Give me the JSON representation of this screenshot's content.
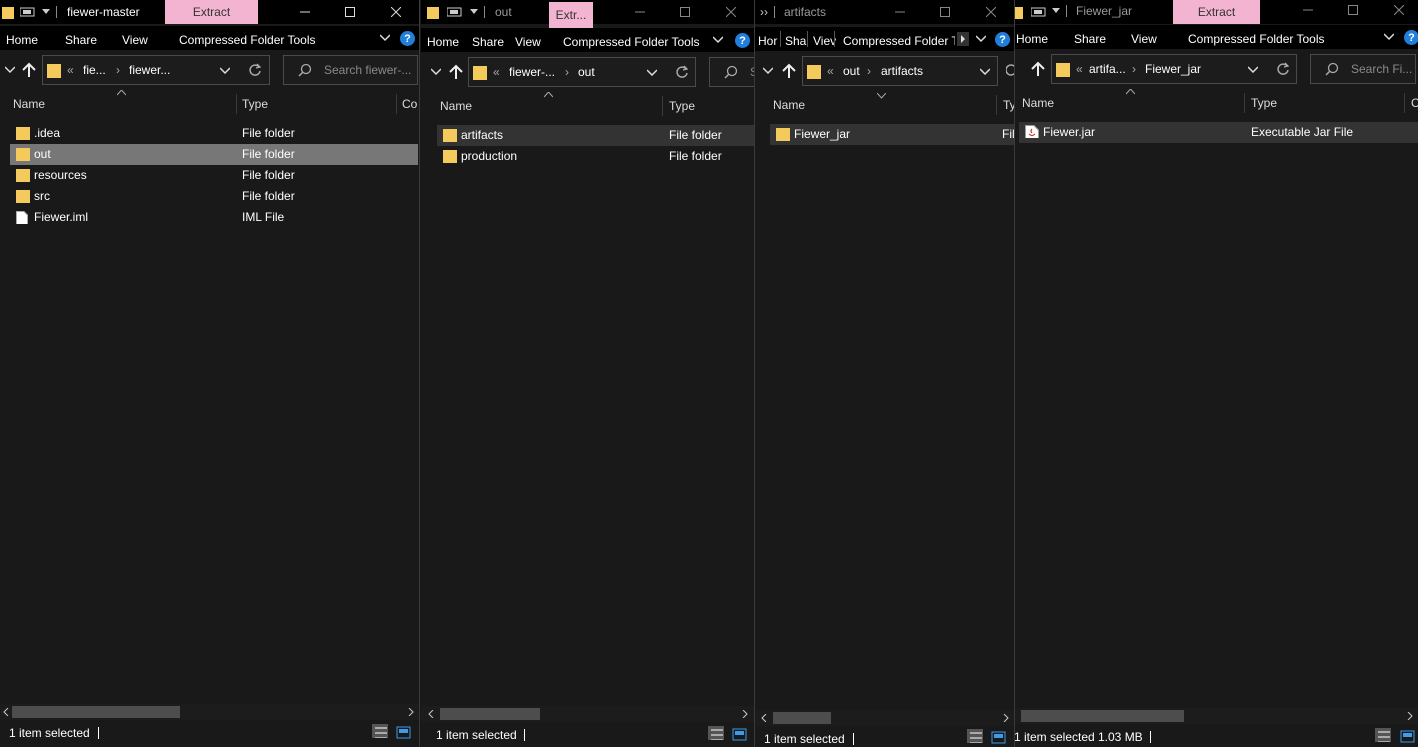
{
  "ribbon_labels": {
    "home": "Home",
    "share": "Share",
    "view": "View",
    "tools": "Compressed Folder Tools"
  },
  "windows": [
    {
      "title": "fiewer-master",
      "extract": "Extract",
      "ribbon": {
        "home": "Home",
        "share": "Share",
        "view": "View",
        "tools": "Compressed Folder Tools"
      },
      "address": {
        "seg1": "fie...",
        "seg2": "fiewer..."
      },
      "search_placeholder": "Search fiewer-...",
      "columns": {
        "name": "Name",
        "type": "Type",
        "extra": "Co"
      },
      "rows": [
        {
          "name": ".idea",
          "type": "File folder"
        },
        {
          "name": "out",
          "type": "File folder"
        },
        {
          "name": "resources",
          "type": "File folder"
        },
        {
          "name": "src",
          "type": "File folder"
        },
        {
          "name": "Fiewer.iml",
          "type": "IML File"
        }
      ],
      "status": "1 item selected"
    },
    {
      "title": "out",
      "extract": "Extr...",
      "ribbon": {
        "home": "Home",
        "share": "Share",
        "view": "View",
        "tools": "Compressed Folder Tools"
      },
      "address": {
        "seg1": "fiewer-...",
        "seg2": "out"
      },
      "search_placeholder": "S",
      "columns": {
        "name": "Name",
        "type": "Type"
      },
      "rows": [
        {
          "name": "artifacts",
          "type": "File folder"
        },
        {
          "name": "production",
          "type": "File folder"
        }
      ],
      "status": "1 item selected"
    },
    {
      "title": "artifacts",
      "ribbon": {
        "home": "Hor",
        "share": "Sha",
        "view": "Viev",
        "tools": "Compressed Folder Tc"
      },
      "address": {
        "seg1": "out",
        "seg2": "artifacts"
      },
      "columns": {
        "name": "Name",
        "type": "Ty"
      },
      "rows": [
        {
          "name": "Fiewer_jar",
          "type": "Fil"
        }
      ],
      "status": "1 item selected"
    },
    {
      "title": "Fiewer_jar",
      "extract": "Extract",
      "ribbon": {
        "home": "Home",
        "share": "Share",
        "view": "View",
        "tools": "Compressed Folder Tools"
      },
      "address": {
        "seg1": "artifa...",
        "seg2": "Fiewer_jar"
      },
      "search_placeholder": "Search Fi...",
      "columns": {
        "name": "Name",
        "type": "Type",
        "extra": "C"
      },
      "rows": [
        {
          "name": "Fiewer.jar",
          "type": "Executable Jar File"
        }
      ],
      "status": "1 item selected",
      "status_size": "1.03 MB"
    }
  ],
  "colors": {
    "folder": "#f4ca5d",
    "accent_help": "#1f7fdb",
    "extract_tab": "#f2b4d1",
    "selection": "#777777"
  }
}
